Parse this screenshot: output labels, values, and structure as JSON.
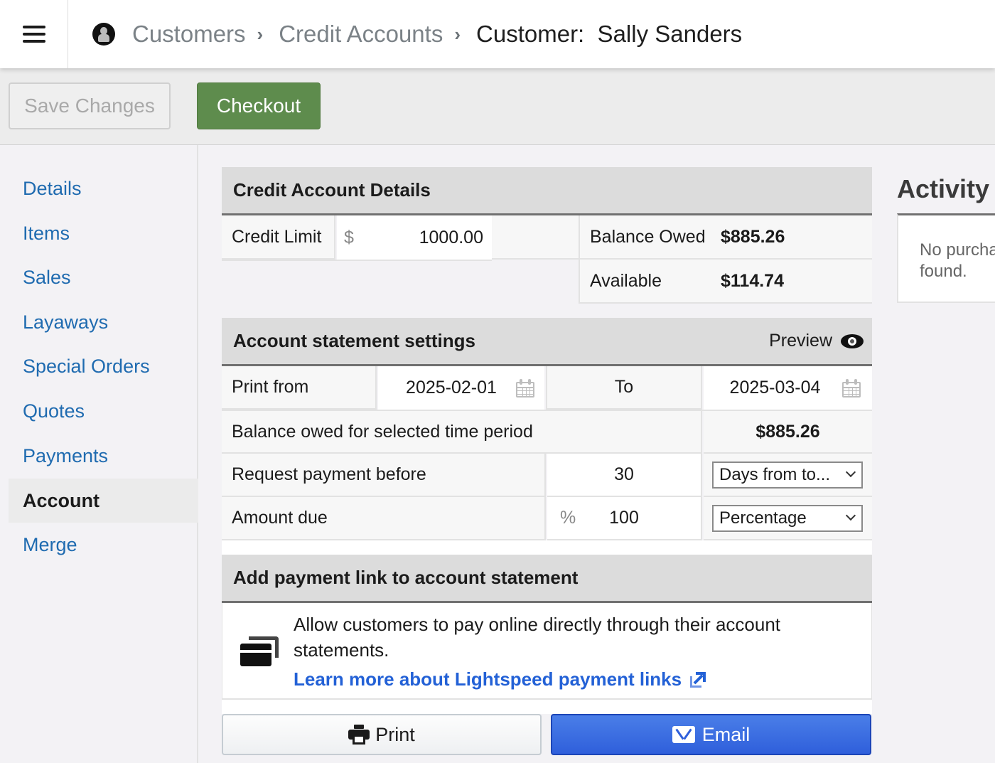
{
  "topbar": {
    "menu_icon": "hamburger-menu-icon",
    "avatar_icon": "user-avatar-icon",
    "breadcrumbs": [
      {
        "label": "Customers"
      },
      {
        "label": "Credit Accounts"
      },
      {
        "label": "Customer:  Sally Sanders"
      }
    ],
    "separator_icon": "chevron-right-icon"
  },
  "toolbar": {
    "save_label": "Save Changes",
    "checkout_label": "Checkout"
  },
  "sidebar": {
    "items": [
      {
        "label": "Details"
      },
      {
        "label": "Items"
      },
      {
        "label": "Sales"
      },
      {
        "label": "Layaways"
      },
      {
        "label": "Special Orders"
      },
      {
        "label": "Quotes"
      },
      {
        "label": "Payments"
      },
      {
        "label": "Account",
        "active": true
      },
      {
        "label": "Merge"
      }
    ]
  },
  "credit_details": {
    "title": "Credit Account Details",
    "credit_limit_label": "Credit Limit",
    "currency_symbol": "$",
    "credit_limit_value": "1000.00",
    "balance_owed_label": "Balance Owed",
    "balance_owed_value": "$885.26",
    "available_label": "Available",
    "available_value": "$114.74"
  },
  "statement_settings": {
    "title": "Account statement settings",
    "preview_label": "Preview",
    "print_from_label": "Print from",
    "print_from_value": "2025-02-01",
    "to_label": "To",
    "to_value": "2025-03-04",
    "balance_period_label": "Balance owed for selected time period",
    "balance_period_value": "$885.26",
    "request_payment_label": "Request payment before",
    "request_payment_value": "30",
    "request_payment_unit": "Days from to...",
    "amount_due_label": "Amount due",
    "amount_due_symbol": "%",
    "amount_due_value": "100",
    "amount_due_type": "Percentage"
  },
  "payment_link": {
    "title": "Add payment link to account statement",
    "description": "Allow customers to pay online directly through their account statements.",
    "learn_more_label": "Learn more about Lightspeed payment links"
  },
  "actions": {
    "print_label": "Print",
    "email_label": "Email"
  },
  "activity": {
    "title": "Activity",
    "empty_message": "No purchases found."
  },
  "colors": {
    "checkout_green": "#5e8c4d",
    "email_blue": "#2f5fdb",
    "link_blue": "#2361d6",
    "sidebar_link": "#1f6bb0"
  }
}
